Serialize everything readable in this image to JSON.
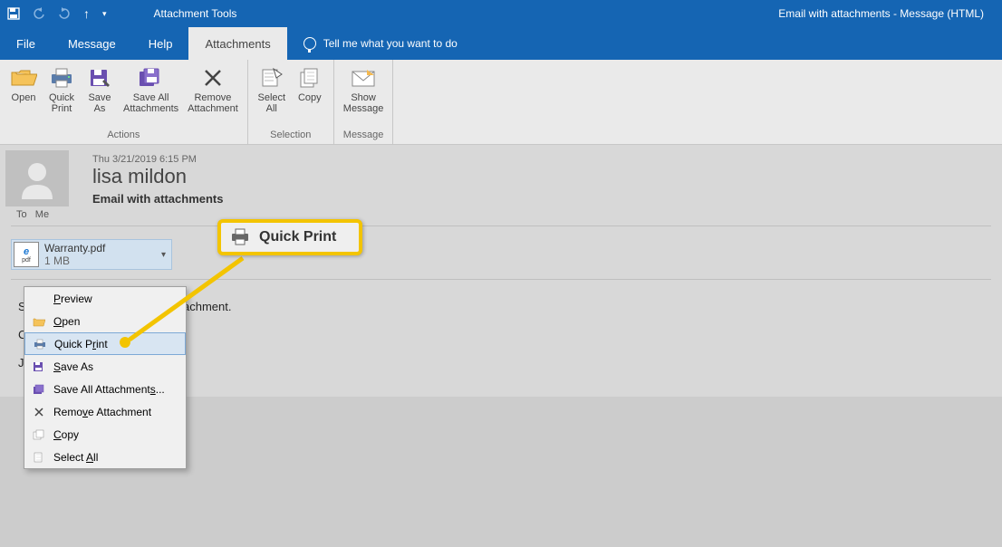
{
  "titlebar": {
    "tooltab": "Attachment Tools",
    "title": "Email with attachments  -  Message (HTML)"
  },
  "menu": {
    "file": "File",
    "message": "Message",
    "help": "Help",
    "attachments": "Attachments",
    "tellme": "Tell me what you want to do"
  },
  "ribbon": {
    "open": "Open",
    "quickprint1": "Quick",
    "quickprint2": "Print",
    "saveas1": "Save",
    "saveas2": "As",
    "saveall1": "Save All",
    "saveall2": "Attachments",
    "remove1": "Remove",
    "remove2": "Attachment",
    "actions": "Actions",
    "selectall1": "Select",
    "selectall2": "All",
    "copy": "Copy",
    "selection": "Selection",
    "show1": "Show",
    "show2": "Message",
    "messagegrp": "Message"
  },
  "email": {
    "date": "Thu 3/21/2019 6:15 PM",
    "sender": "lisa mildon",
    "subject": "Email with attachments",
    "to_label": "To",
    "to_value": "Me"
  },
  "attachment": {
    "name": "Warranty.pdf",
    "size": "1 MB",
    "pdf": "pdf"
  },
  "body": {
    "line1_vis": "Se",
    "line1_rest": "tachment.",
    "line2_vis": "Cl",
    "line3_vis": "Ja"
  },
  "ctx": {
    "preview": "Preview",
    "open": "Open",
    "quickprint": "Quick Print",
    "saveas": "Save As",
    "saveall": "Save All Attachments...",
    "remove": "Remove Attachment",
    "copy": "Copy",
    "selectall": "Select All"
  },
  "callout": {
    "label": "Quick Print"
  }
}
